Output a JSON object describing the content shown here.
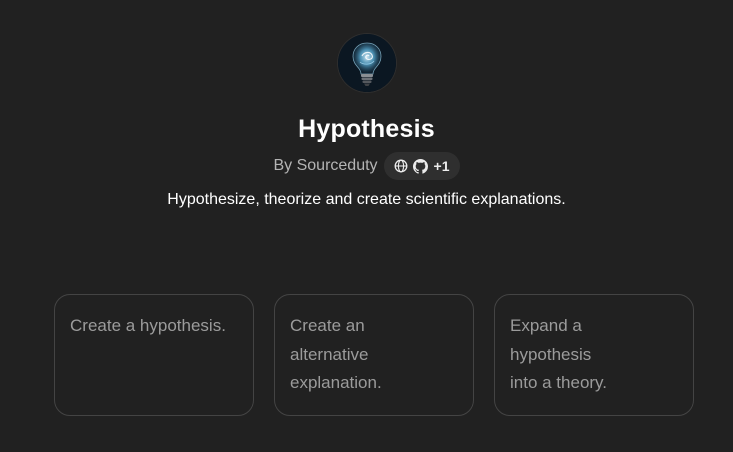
{
  "gpt": {
    "avatar_icon": "lightbulb-icon",
    "title": "Hypothesis",
    "author": "By Sourceduty",
    "links": {
      "globe_icon": "globe-icon",
      "github_icon": "github-icon",
      "extra_count": "+1"
    },
    "description": "Hypothesize, theorize and create scientific explanations."
  },
  "conversation_starters": [
    {
      "lines": [
        "Create a hypothesis."
      ]
    },
    {
      "lines": [
        "Create an",
        "alternative",
        "explanation."
      ]
    },
    {
      "lines": [
        "Expand a",
        "hypothesis",
        "into a theory."
      ]
    }
  ],
  "colors": {
    "background": "#212121",
    "title": "#ffffff",
    "muted_text": "#b4b4b4",
    "starter_text": "#9b9b9b",
    "starter_border": "#444444",
    "pill_background": "#2f2f2f"
  }
}
